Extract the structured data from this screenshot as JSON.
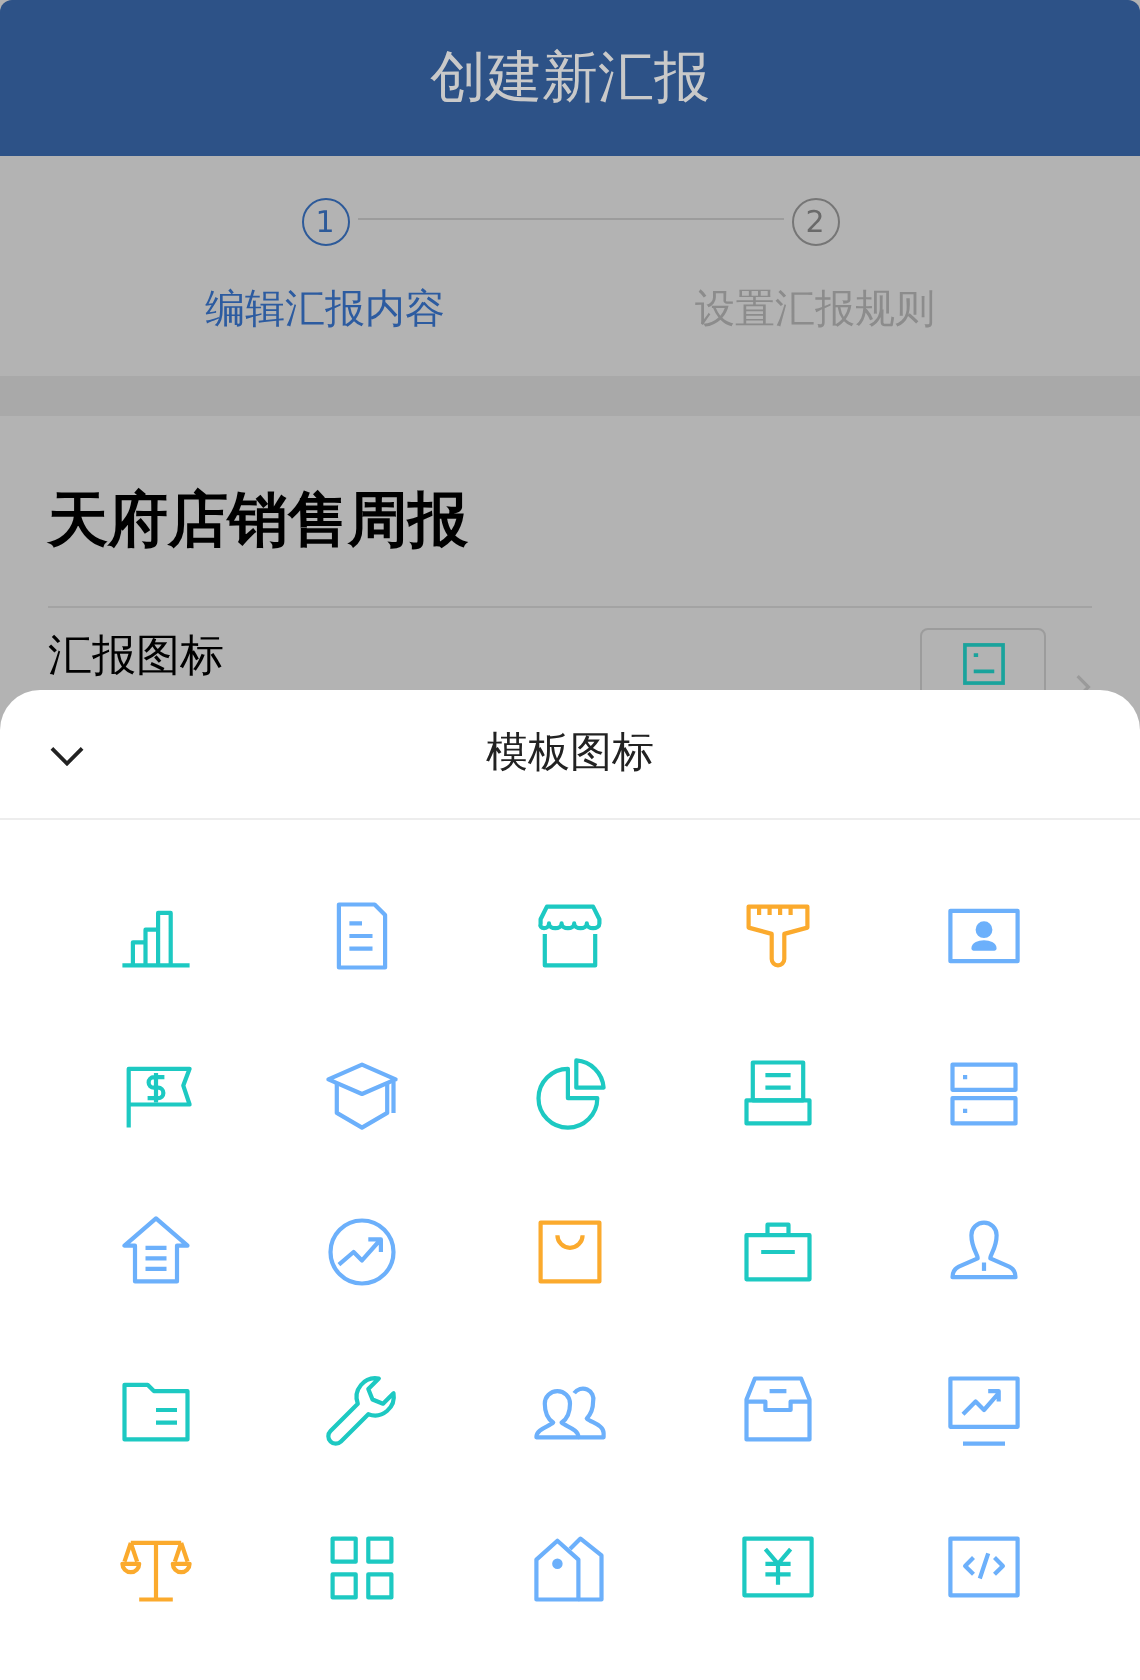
{
  "header": {
    "title": "创建新汇报"
  },
  "steps": [
    {
      "number": "1",
      "label": "编辑汇报内容",
      "selected": true
    },
    {
      "number": "2",
      "label": "设置汇报规则",
      "selected": false
    }
  ],
  "report": {
    "title": "天府店销售周报",
    "icon_row_label": "汇报图标"
  },
  "sheet": {
    "title": "模板图标",
    "icons": [
      {
        "kind": "bar-chart",
        "color": "#1dc9c2"
      },
      {
        "kind": "document",
        "color": "#6cb0fb"
      },
      {
        "kind": "store",
        "color": "#1dc9c2"
      },
      {
        "kind": "brush",
        "color": "#fbaa2d"
      },
      {
        "kind": "id-card",
        "color": "#6cb0fb"
      },
      {
        "kind": "flag-dollar",
        "color": "#1dc9c2"
      },
      {
        "kind": "cap",
        "color": "#6cb0fb"
      },
      {
        "kind": "pie",
        "color": "#1dc9c2"
      },
      {
        "kind": "printer",
        "color": "#1dc9c2"
      },
      {
        "kind": "server",
        "color": "#6cb0fb"
      },
      {
        "kind": "house",
        "color": "#6cb0fb"
      },
      {
        "kind": "trend-circle",
        "color": "#6cb0fb"
      },
      {
        "kind": "bag",
        "color": "#fbaa2d"
      },
      {
        "kind": "briefcase",
        "color": "#1dc9c2"
      },
      {
        "kind": "person",
        "color": "#6cb0fb"
      },
      {
        "kind": "folder",
        "color": "#1dc9c2"
      },
      {
        "kind": "wrench",
        "color": "#1dc9c2"
      },
      {
        "kind": "people",
        "color": "#6cb0fb"
      },
      {
        "kind": "inbox",
        "color": "#6cb0fb"
      },
      {
        "kind": "monitor",
        "color": "#6cb0fb"
      },
      {
        "kind": "scale",
        "color": "#fbaa2d"
      },
      {
        "kind": "grid",
        "color": "#1dc9c2"
      },
      {
        "kind": "tags",
        "color": "#6cb0fb"
      },
      {
        "kind": "yen",
        "color": "#1dc9c2"
      },
      {
        "kind": "code",
        "color": "#6cb0fb"
      }
    ]
  }
}
